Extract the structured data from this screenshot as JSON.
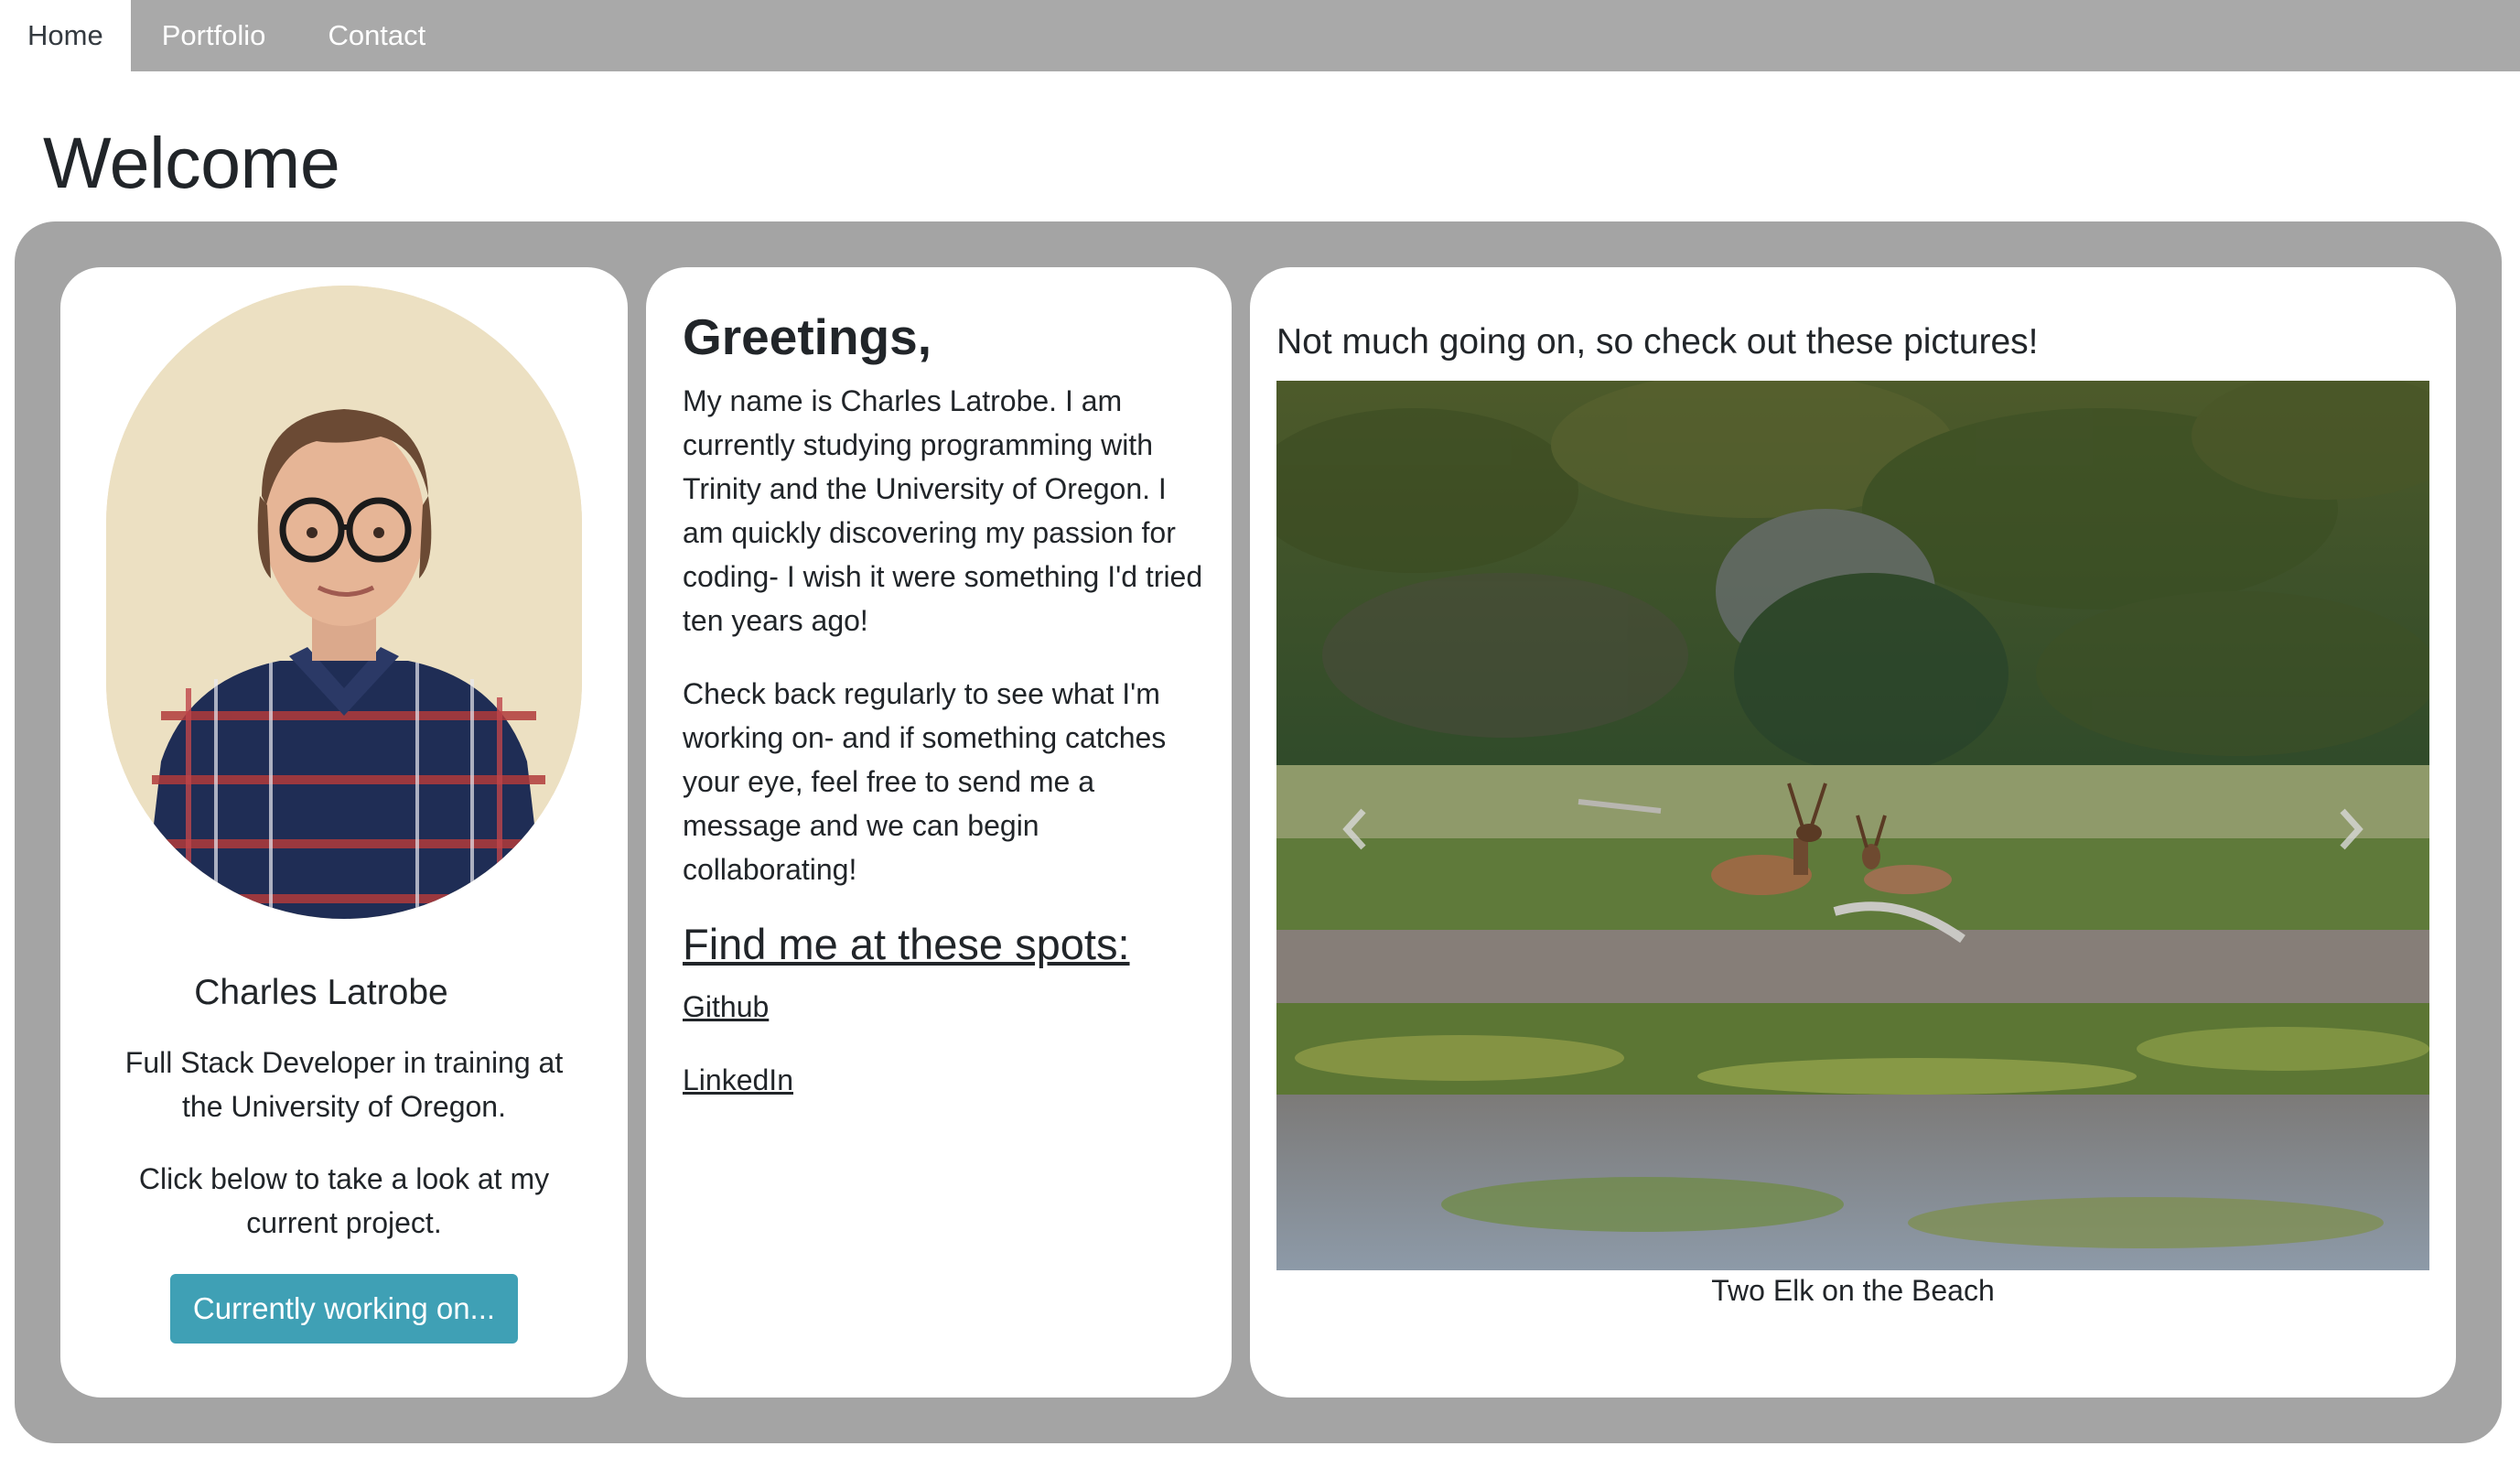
{
  "nav": {
    "tabs": [
      {
        "label": "Home",
        "active": true
      },
      {
        "label": "Portfolio",
        "active": false
      },
      {
        "label": "Contact",
        "active": false
      }
    ]
  },
  "page": {
    "title": "Welcome"
  },
  "profile": {
    "name": "Charles Latrobe",
    "role": "Full Stack Developer in training at the University of Oregon.",
    "cta_text": "Click below to take a look at my current project.",
    "button_label": "Currently working on..."
  },
  "greeting": {
    "title": "Greetings,",
    "paragraph1": "My name is Charles Latrobe. I am currently studying programming with Trinity and the University of Oregon. I am quickly discovering my passion for coding- I wish it were something I'd tried ten years ago!",
    "paragraph2": "Check back regularly to see what I'm working on- and if something catches your eye, feel free to send me a message and we can begin collaborating!",
    "find_title": "Find me at these spots:",
    "links": [
      {
        "label": "Github"
      },
      {
        "label": "LinkedIn"
      }
    ]
  },
  "photos": {
    "title": "Not much going on, so check out these pictures!",
    "caption": "Two Elk on the Beach",
    "prev_icon": "chevron-left-icon",
    "next_icon": "chevron-right-icon"
  },
  "colors": {
    "nav_bg": "#a9a9a9",
    "panel_bg": "#a4a4a4",
    "button_bg": "#3fa0b5",
    "card_bg": "#ffffff"
  }
}
